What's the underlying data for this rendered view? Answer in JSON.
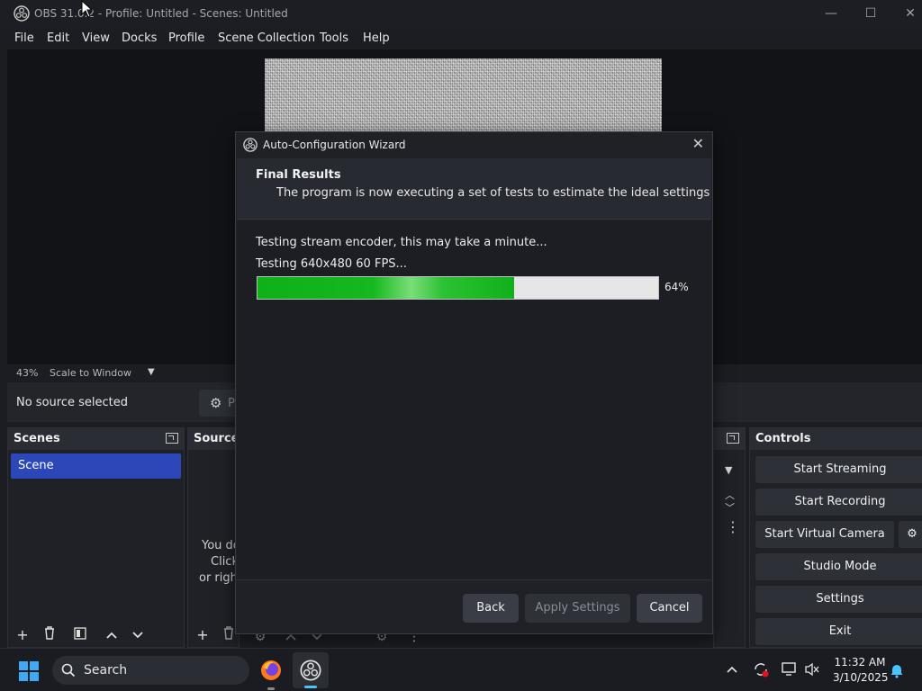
{
  "window": {
    "title": "OBS 31.0.2 - Profile: Untitled - Scenes: Untitled"
  },
  "menu": [
    "File",
    "Edit",
    "View",
    "Docks",
    "Profile",
    "Scene Collection",
    "Tools",
    "Help"
  ],
  "preview": {
    "zoom": "43%",
    "scale_mode": "Scale to Window"
  },
  "source_bar": {
    "status": "No source selected",
    "properties_label": "Pr"
  },
  "scenes": {
    "title": "Scenes",
    "items": [
      "Scene"
    ]
  },
  "sources": {
    "title": "Sourcer",
    "empty_lines": [
      "You do",
      "Click",
      "or right"
    ]
  },
  "controls": {
    "title": "Controls",
    "start_streaming": "Start Streaming",
    "start_recording": "Start Recording",
    "start_virtual_camera": "Start Virtual Camera",
    "studio_mode": "Studio Mode",
    "settings": "Settings",
    "exit": "Exit"
  },
  "dialog": {
    "title": "Auto-Configuration Wizard",
    "header_title": "Final Results",
    "header_subtitle": "The program is now executing a set of tests to estimate the ideal settings",
    "status_line1": "Testing stream encoder, this may take a minute...",
    "status_line2": "Testing 640x480 60 FPS...",
    "progress_percent": 64,
    "progress_label": "64%",
    "back": "Back",
    "apply": "Apply Settings",
    "cancel": "Cancel"
  },
  "taskbar": {
    "search": "Search",
    "time": "11:32 AM",
    "date": "3/10/2025"
  },
  "colors": {
    "accent_green": "#0fb01a",
    "scene_selected": "#2c48b8"
  }
}
